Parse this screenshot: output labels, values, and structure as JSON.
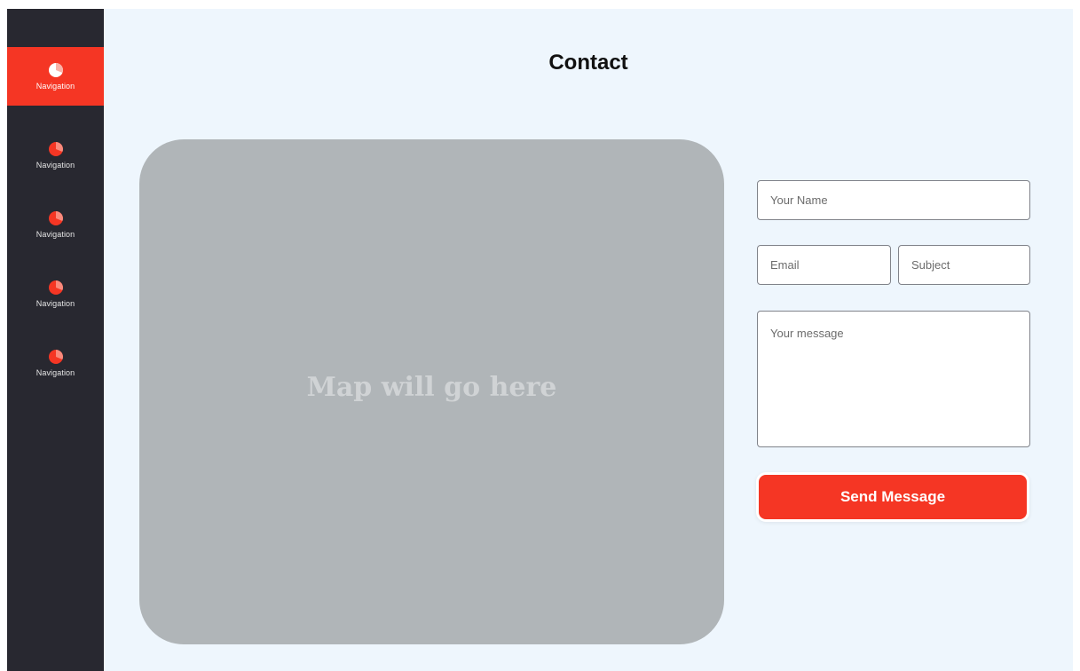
{
  "sidebar": {
    "items": [
      {
        "label": "Navigation",
        "icon": "pie-chart-icon",
        "active": true
      },
      {
        "label": "Navigation",
        "icon": "pie-chart-icon",
        "active": false
      },
      {
        "label": "Navigation",
        "icon": "pie-chart-icon",
        "active": false
      },
      {
        "label": "Navigation",
        "icon": "pie-chart-icon",
        "active": false
      },
      {
        "label": "Navigation",
        "icon": "pie-chart-icon",
        "active": false
      }
    ]
  },
  "page": {
    "title": "Contact"
  },
  "map": {
    "placeholder_text": "Map will go here"
  },
  "form": {
    "name_placeholder": "Your Name",
    "name_value": "",
    "email_placeholder": "Email",
    "email_value": "",
    "subject_placeholder": "Subject",
    "subject_value": "",
    "message_placeholder": "Your message",
    "message_value": "",
    "submit_label": "Send Message"
  },
  "colors": {
    "accent": "#f53624",
    "sidebar_bg": "#282830",
    "main_bg": "#eef6fd",
    "map_bg": "#b0b5b8",
    "icon_light": "#f98a7c"
  }
}
